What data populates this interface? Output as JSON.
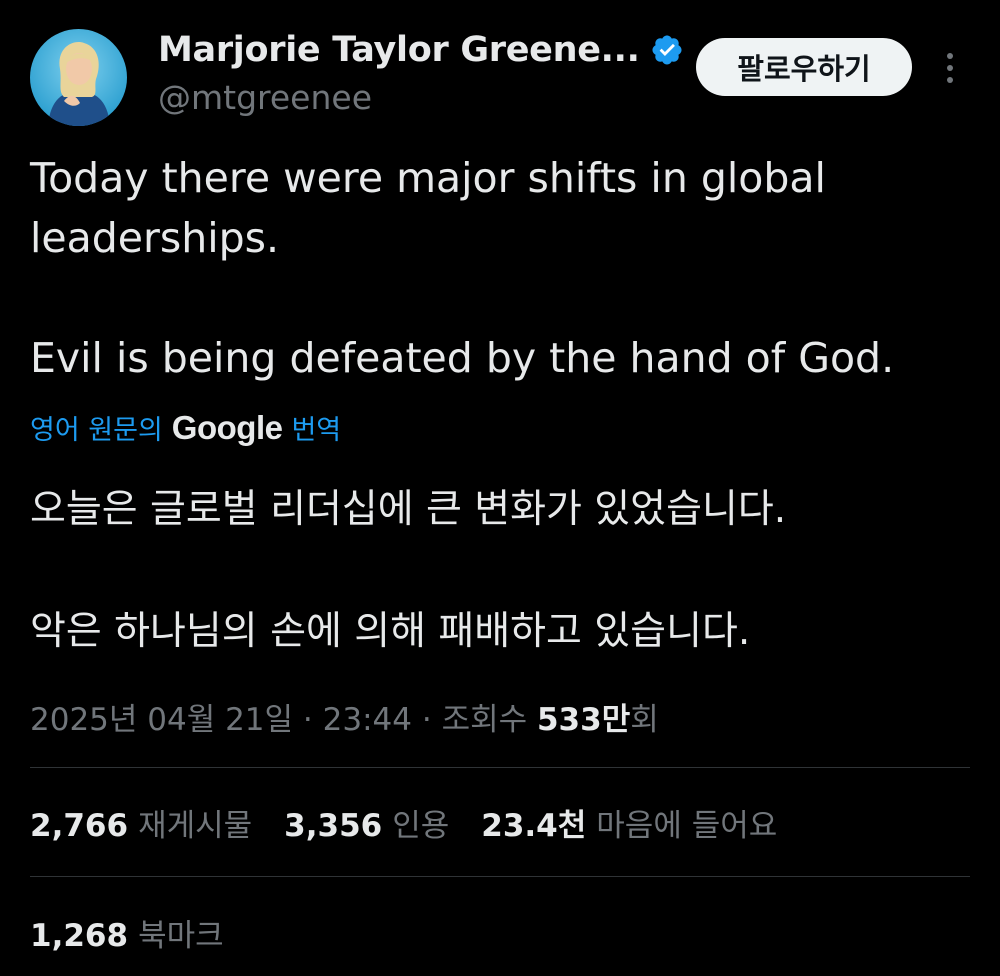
{
  "author": {
    "display_name": "Marjorie Taylor Greene...",
    "handle": "@mtgreenee",
    "verified_icon": "verified-badge-icon",
    "avatar": "avatar-photo"
  },
  "header": {
    "follow_label": "팔로우하기",
    "more_icon": "more-vertical-icon"
  },
  "tweet": {
    "paragraphs": [
      "Today there were major shifts in global leaderships.",
      "Evil is being defeated by the hand of God."
    ],
    "translation_prefix": "영어 원문의",
    "translation_provider": "Google",
    "translation_suffix": "번역",
    "translated_paragraphs": [
      "오늘은 글로벌 리더십에 큰 변화가 있었습니다.",
      "악은 하나님의 손에 의해 패배하고 있습니다."
    ]
  },
  "meta": {
    "date": "2025년 04월 21일",
    "separator": "·",
    "time": "23:44",
    "views_label": "조회수",
    "views_count": "533만",
    "views_suffix": "회"
  },
  "stats": {
    "reposts_count": "2,766",
    "reposts_label": "재게시물",
    "quotes_count": "3,356",
    "quotes_label": "인용",
    "likes_count": "23.4천",
    "likes_label": "마음에 들어요",
    "bookmarks_count": "1,268",
    "bookmarks_label": "북마크"
  },
  "colors": {
    "background": "#000000",
    "text": "#e7e9ea",
    "muted": "#71767b",
    "accent": "#1d9bf0",
    "divider": "#2f3336"
  }
}
